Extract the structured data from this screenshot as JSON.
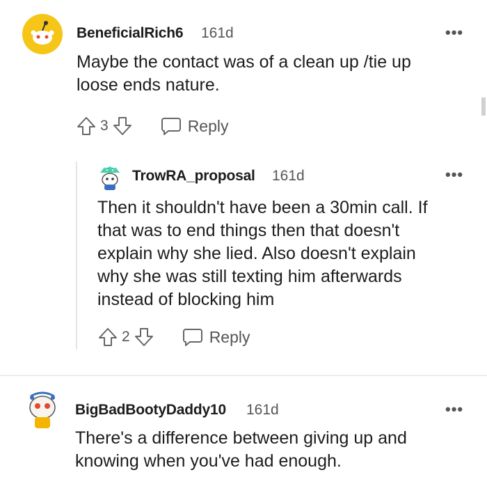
{
  "comments": [
    {
      "username": "BeneficialRich6",
      "age": "161d",
      "text_lines": [
        "Maybe the contact was of a clean up /tie up",
        "loose ends nature."
      ],
      "score": "3",
      "reply_label": "Reply",
      "more_label": "•••",
      "avatar_icon": "snoo-avatar-yellow"
    },
    {
      "username": "TrowRA_proposal",
      "age": "161d",
      "text_lines": [
        "Then it shouldn't have been a 30min call. If",
        "that was to end things then that doesn't",
        "explain why she lied. Also doesn't explain",
        "why she was still texting him afterwards",
        "instead of blocking him"
      ],
      "score": "2",
      "reply_label": "Reply",
      "more_label": "•••",
      "avatar_icon": "snoo-avatar-green-hair"
    },
    {
      "username": "BigBadBootyDaddy10",
      "age": "161d",
      "text_lines": [
        "There's a difference between giving up and",
        "knowing when you've had enough."
      ],
      "more_label": "•••",
      "avatar_icon": "snoo-avatar-red"
    }
  ],
  "colors": {
    "avatar_yellow": "#f5c518",
    "thread_line": "#e5e5e5",
    "text": "#1c1c1c",
    "meta": "#555555"
  }
}
